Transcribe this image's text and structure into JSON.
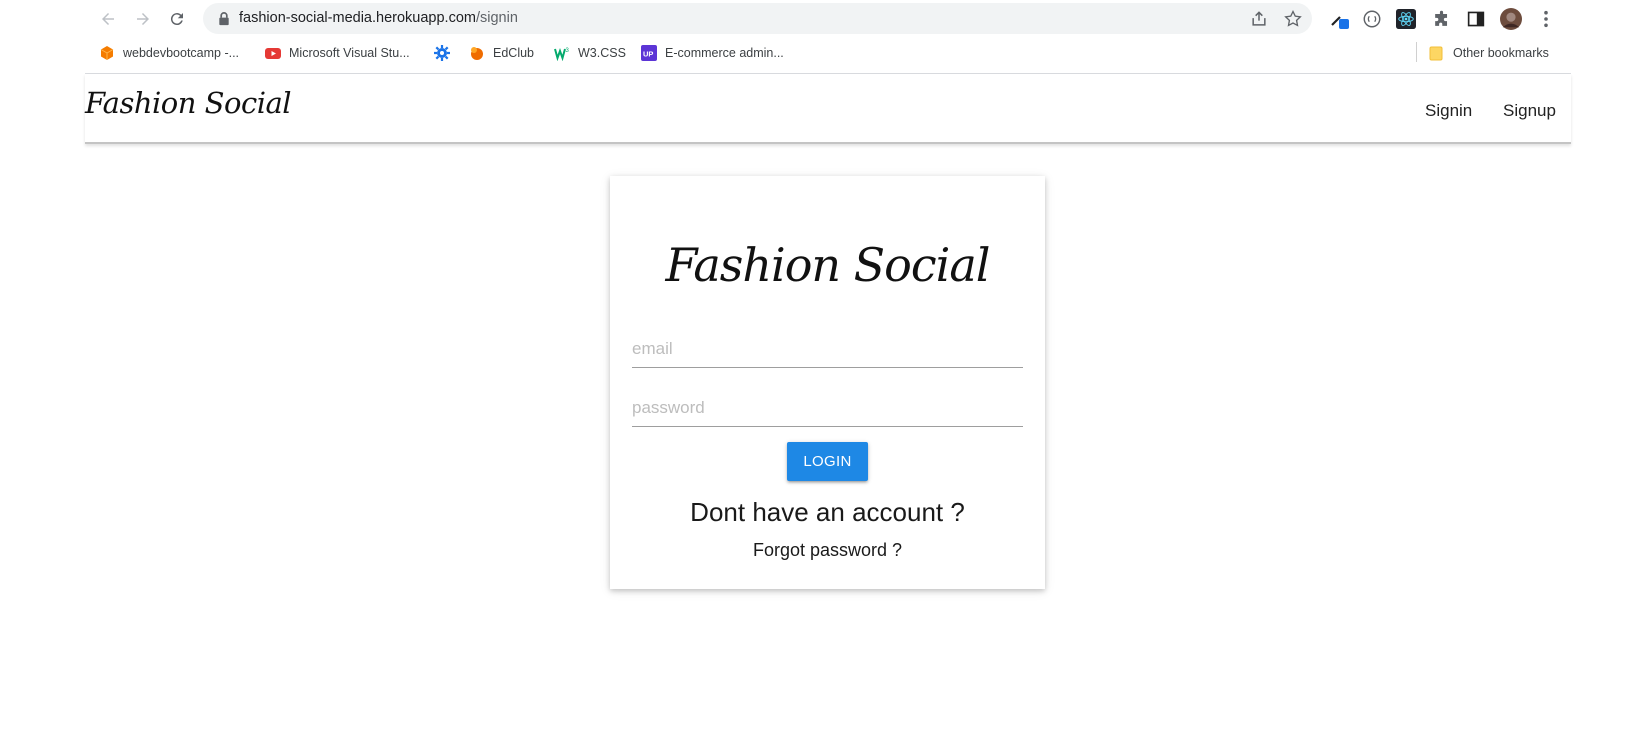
{
  "browser": {
    "url_host": "fashion-social-media.herokuapp.com",
    "url_path": "/signin",
    "bookmarks": [
      {
        "label": "webdevbootcamp -...",
        "icon": "cube-icon",
        "color": "#f57c00"
      },
      {
        "label": "Microsoft Visual Stu...",
        "icon": "youtube-icon",
        "color": "#e53935"
      },
      {
        "label": "",
        "icon": "gear-icon",
        "color": "#1a73e8"
      },
      {
        "label": "EdClub",
        "icon": "edclub-icon",
        "color": "#ef6c00"
      },
      {
        "label": "W3.CSS",
        "icon": "w3-icon",
        "color": "#04aa6d"
      },
      {
        "label": "E-commerce admin...",
        "icon": "up-icon",
        "color": "#5c35d6"
      }
    ],
    "other_bookmarks": "Other bookmarks"
  },
  "navbar": {
    "brand": "Fashion Social",
    "links": {
      "signin": "Signin",
      "signup": "Signup"
    }
  },
  "signin": {
    "title": "Fashion Social",
    "email_placeholder": "email",
    "password_placeholder": "password",
    "login_label": "LOGIN",
    "signup_prompt": "Dont have an account ?",
    "forgot_password": "Forgot password ?",
    "accent_color": "#1e88e5"
  }
}
